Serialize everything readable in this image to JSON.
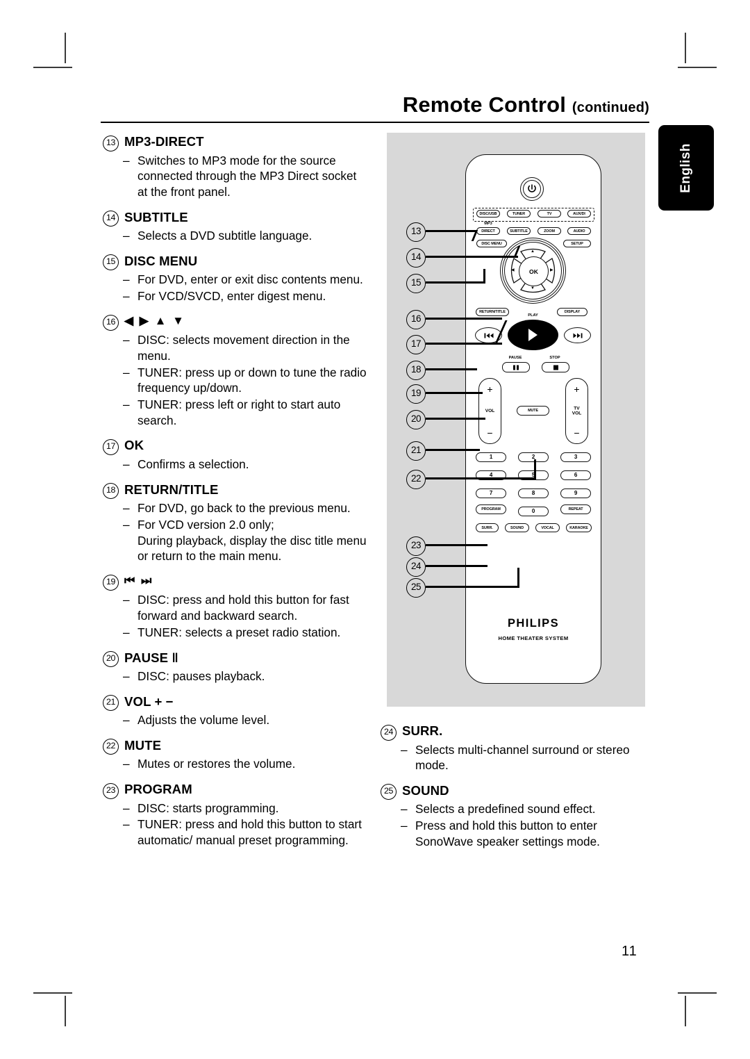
{
  "header": {
    "title": "Remote Control",
    "continued": "(continued)"
  },
  "language_tab": "English",
  "page_number": "11",
  "left_column": [
    {
      "num": "13",
      "label": "MP3-DIRECT",
      "bullets": [
        "Switches to MP3 mode for the source connected through the MP3 Direct socket at the front panel."
      ]
    },
    {
      "num": "14",
      "label": "SUBTITLE",
      "bullets": [
        "Selects a DVD subtitle language."
      ]
    },
    {
      "num": "15",
      "label": "DISC MENU",
      "bullets": [
        "For DVD, enter or exit disc contents menu.",
        "For VCD/SVCD, enter digest menu."
      ]
    },
    {
      "num": "16",
      "label": "◀ ▶ ▲ ▼",
      "bullets": [
        "DISC: selects movement direction in the menu.",
        "TUNER: press up or down to tune the radio frequency up/down.",
        "TUNER: press left or right to start auto search."
      ]
    },
    {
      "num": "17",
      "label": "OK",
      "bullets": [
        "Confirms a selection."
      ]
    },
    {
      "num": "18",
      "label": "RETURN/TITLE",
      "bullets": [
        "For DVD, go back to the previous menu.",
        "For VCD version 2.0 only;"
      ],
      "subtext": "During playback, display the disc title menu or return to the main menu."
    },
    {
      "num": "19",
      "label": "⏮ ⏭",
      "bullets": [
        "DISC: press and hold this button for fast forward and backward search.",
        "TUNER: selects a preset radio station."
      ]
    },
    {
      "num": "20",
      "label": "PAUSE ‖",
      "bullets": [
        "DISC: pauses playback."
      ]
    },
    {
      "num": "21",
      "label": "VOL + −",
      "bullets": [
        "Adjusts the volume level."
      ]
    },
    {
      "num": "22",
      "label": "MUTE",
      "bullets": [
        "Mutes or restores the volume."
      ]
    },
    {
      "num": "23",
      "label": "PROGRAM",
      "bullets": [
        "DISC: starts programming.",
        "TUNER: press and hold this button to start automatic/ manual preset programming."
      ]
    }
  ],
  "right_column": [
    {
      "num": "24",
      "label": "SURR.",
      "bullets": [
        "Selects multi-channel surround or stereo mode."
      ]
    },
    {
      "num": "25",
      "label": "SOUND",
      "bullets": [
        "Selects a predefined sound effect.",
        "Press and hold this button to enter SonoWave speaker settings mode."
      ]
    }
  ],
  "remote": {
    "brand": "PHILIPS",
    "subbrand": "HOME THEATER SYSTEM",
    "power_icon": "power-standby-icon",
    "source_row": [
      "DISC/USB",
      "TUNER",
      "TV",
      "AUX/DI"
    ],
    "mp3_label": "MP3",
    "row2": [
      "DIRECT",
      "SUBTITLE",
      "ZOOM",
      "AUDIO"
    ],
    "row3": [
      "DISC MENU",
      "SETUP"
    ],
    "dpad": {
      "up": "▲",
      "down": "▼",
      "left": "◀",
      "right": "▶",
      "ok": "OK"
    },
    "row4": [
      "RETURN/TITLE",
      "DISPLAY"
    ],
    "play_label": "PLAY",
    "skip_prev": "⏮",
    "skip_next": "⏭",
    "pause_label": "PAUSE",
    "stop_label": "STOP",
    "vol_label": "VOL",
    "tvvol_label": "TV\nVOL",
    "tvvol_line1": "TV",
    "tvvol_line2": "VOL",
    "mute_label": "MUTE",
    "plus": "+",
    "minus": "−",
    "numpad": [
      "1",
      "2",
      "3",
      "4",
      "5",
      "6",
      "7",
      "8",
      "9"
    ],
    "numpad_row4": [
      "PROGRAM",
      "0",
      "REPEAT"
    ],
    "bottom_row": [
      "SURR.",
      "SOUND",
      "VOCAL",
      "KARAOKE"
    ]
  },
  "callouts": [
    "13",
    "14",
    "15",
    "16",
    "17",
    "18",
    "19",
    "20",
    "21",
    "22",
    "23",
    "24",
    "25"
  ]
}
